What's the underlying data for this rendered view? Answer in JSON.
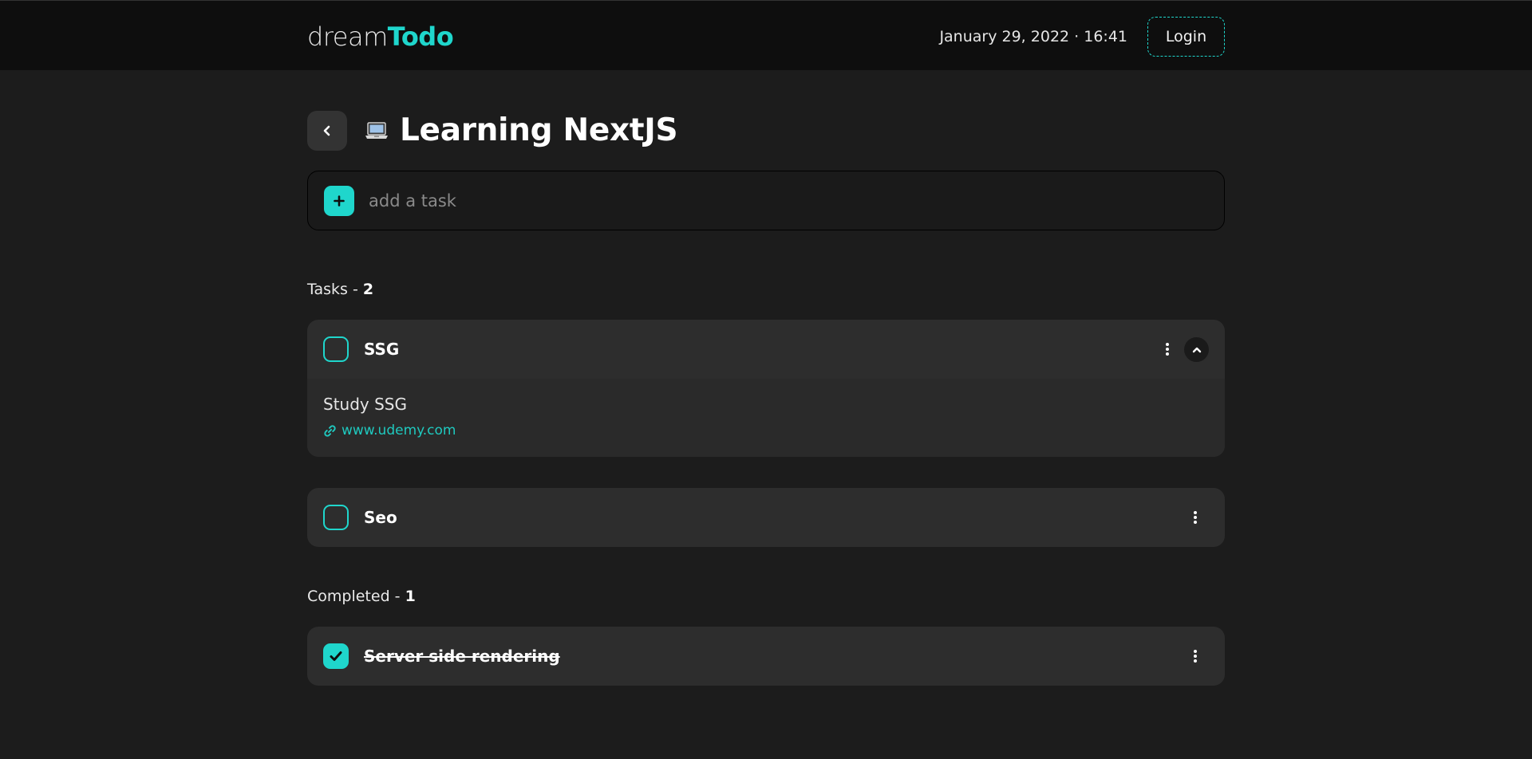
{
  "header": {
    "brand_light": "dream",
    "brand_bold": "Todo",
    "datetime": "January 29, 2022 · 16:41",
    "login_label": "Login"
  },
  "page": {
    "emoji": "laptop-icon",
    "title": "Learning NextJS",
    "add_placeholder": "add a task"
  },
  "tasks_section": {
    "label": "Tasks - ",
    "count": "2"
  },
  "tasks": [
    {
      "title": "SSG",
      "description": "Study SSG",
      "link": "www.udemy.com",
      "expanded": true,
      "completed": false
    },
    {
      "title": "Seo",
      "expanded": false,
      "completed": false
    }
  ],
  "completed_section": {
    "label": "Completed - ",
    "count": "1"
  },
  "completed": [
    {
      "title": "Server side rendering",
      "completed": true
    }
  ],
  "colors": {
    "accent": "#1fd6cc",
    "background": "#1c1c1c",
    "header": "#0e0e0e",
    "card": "#2d2d2d"
  }
}
